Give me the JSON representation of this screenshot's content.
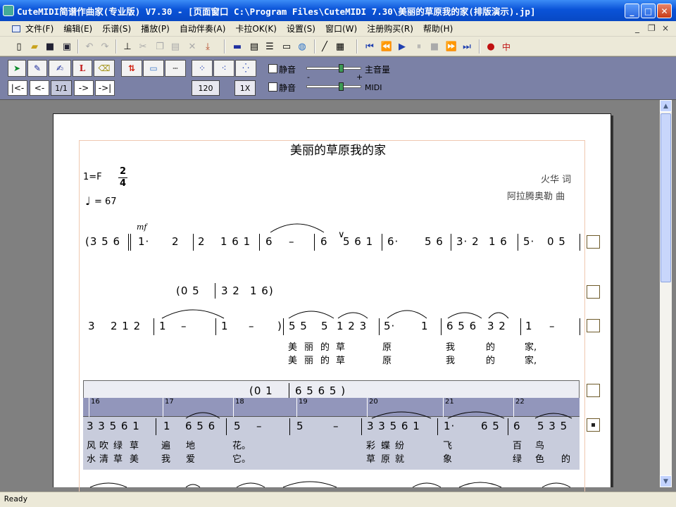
{
  "window": {
    "title": "CuteMIDI简谱作曲家(专业版) V7.30 - [页面窗口  C:\\Program Files\\CuteMIDI 7.30\\美丽的草原我的家(排版演示).jp]",
    "min": "_",
    "max": "□",
    "close": "✕"
  },
  "menu": [
    "文件(F)",
    "编辑(E)",
    "乐谱(S)",
    "播放(P)",
    "自动伴奏(A)",
    "卡拉OK(K)",
    "设置(S)",
    "窗口(W)",
    "注册购买(R)",
    "帮助(H)"
  ],
  "mdi": {
    "min": "_",
    "restore": "❐",
    "close": "×"
  },
  "panel": {
    "page_prev_all": "|<-",
    "page_prev": "<-",
    "page_counter": "1/1",
    "page_next": "->",
    "page_next_all": "->|",
    "tempo": "120",
    "speed": "1X",
    "mute1": "静音",
    "mute2": "静音",
    "master_label": "主音量",
    "midi_label": "MIDI",
    "minus": "-",
    "plus": "+",
    "tool_l": "L"
  },
  "score": {
    "title": "美丽的草原我的家",
    "key": "1=F",
    "time_top": "2",
    "time_bottom": "4",
    "tempo": "= 67",
    "lyricist": "火华  词",
    "composer": "阿拉腾奥勒  曲",
    "dyn": "mf",
    "breath": "∨",
    "row1": [
      "(3 5 6",
      "1·",
      "2",
      "2",
      "1 6 1",
      "6",
      "–",
      "6",
      "5 6 1",
      "6·",
      "5 6",
      "3· 2",
      "1 6",
      "5·",
      "0 5"
    ],
    "row2_paren": [
      "(0 5",
      "3 2",
      "1 6)"
    ],
    "row3": [
      "3",
      "2 1 2",
      "1",
      "–",
      "1",
      "–",
      ")",
      "5 5",
      "5",
      "1 2 3",
      "5·",
      "1",
      "6 5 6",
      "3 2",
      "1",
      "–"
    ],
    "lyric1": [
      "美",
      "丽",
      "的",
      "草",
      "原",
      "我",
      "的",
      "家,"
    ],
    "lyric2": [
      "美",
      "丽",
      "的",
      "草",
      "原",
      "我",
      "的",
      "家,"
    ],
    "row4_paren": [
      "(0 1",
      "6 5 6 5 )"
    ],
    "measures": [
      "16",
      "17",
      "18",
      "19",
      "20",
      "21",
      "22"
    ],
    "row5": [
      "3 3 5 6 1",
      "1",
      "6 5 6",
      "5",
      "–",
      "5",
      "–",
      "3 3 5 6 1",
      "1·",
      "6 5",
      "6",
      "5 3 5"
    ],
    "lyric3": [
      "风",
      "吹",
      "绿",
      "草",
      "遍",
      "地",
      "花。",
      "彩",
      "蝶",
      "纷",
      "飞",
      "百",
      "鸟"
    ],
    "lyric4": [
      "水",
      "清",
      "草",
      "美",
      "我",
      "爱",
      "它。",
      "草",
      "原",
      "就",
      "象",
      "绿",
      "色",
      "的"
    ]
  },
  "status": "Ready"
}
